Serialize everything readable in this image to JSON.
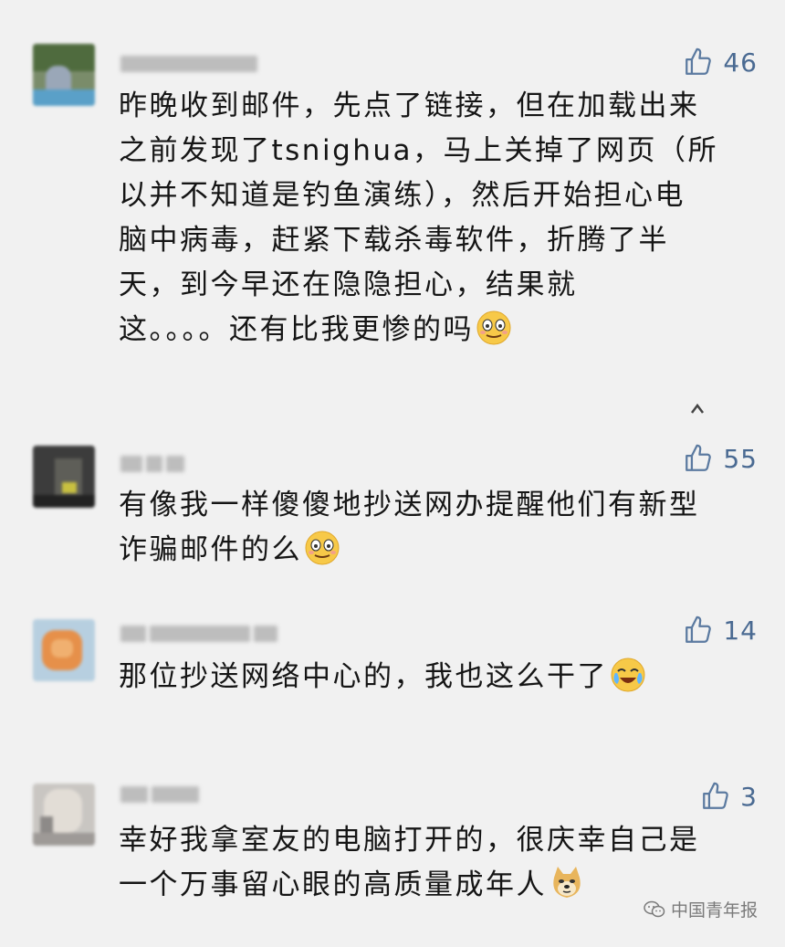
{
  "comments": [
    {
      "likes": "46",
      "text": "昨晚收到邮件，先点了链接，但在加载出来\n之前发现了tsnighua，马上关掉了网页（所\n以并不知道是钓鱼演练），然后开始担心电\n脑中病毒，赶紧下载杀毒软件，折腾了半\n天，到今早还在隐隐担心，结果就\n这。。。。还有比我更惨的吗",
      "emoji": "awkward-smile-emoji"
    },
    {
      "likes": "55",
      "text": "有像我一样傻傻地抄送网办提醒他们有新型\n诈骗邮件的么",
      "emoji": "awkward-smile-emoji"
    },
    {
      "likes": "14",
      "text": "那位抄送网络中心的，我也这么干了",
      "emoji": "crying-laughing-emoji"
    },
    {
      "likes": "3",
      "text": "幸好我拿室友的电脑打开的，很庆幸自己是\n一个万事留心眼的高质量成年人",
      "emoji": "doge-emoji"
    }
  ],
  "watermark": {
    "label": "中国青年报",
    "icon": "wechat-icon"
  },
  "icons": {
    "like": "thumbs-up-icon",
    "more": "more-icon"
  },
  "colors": {
    "background": "#f1f1f1",
    "like_icon": "#5b7aa0",
    "text": "#151515"
  }
}
